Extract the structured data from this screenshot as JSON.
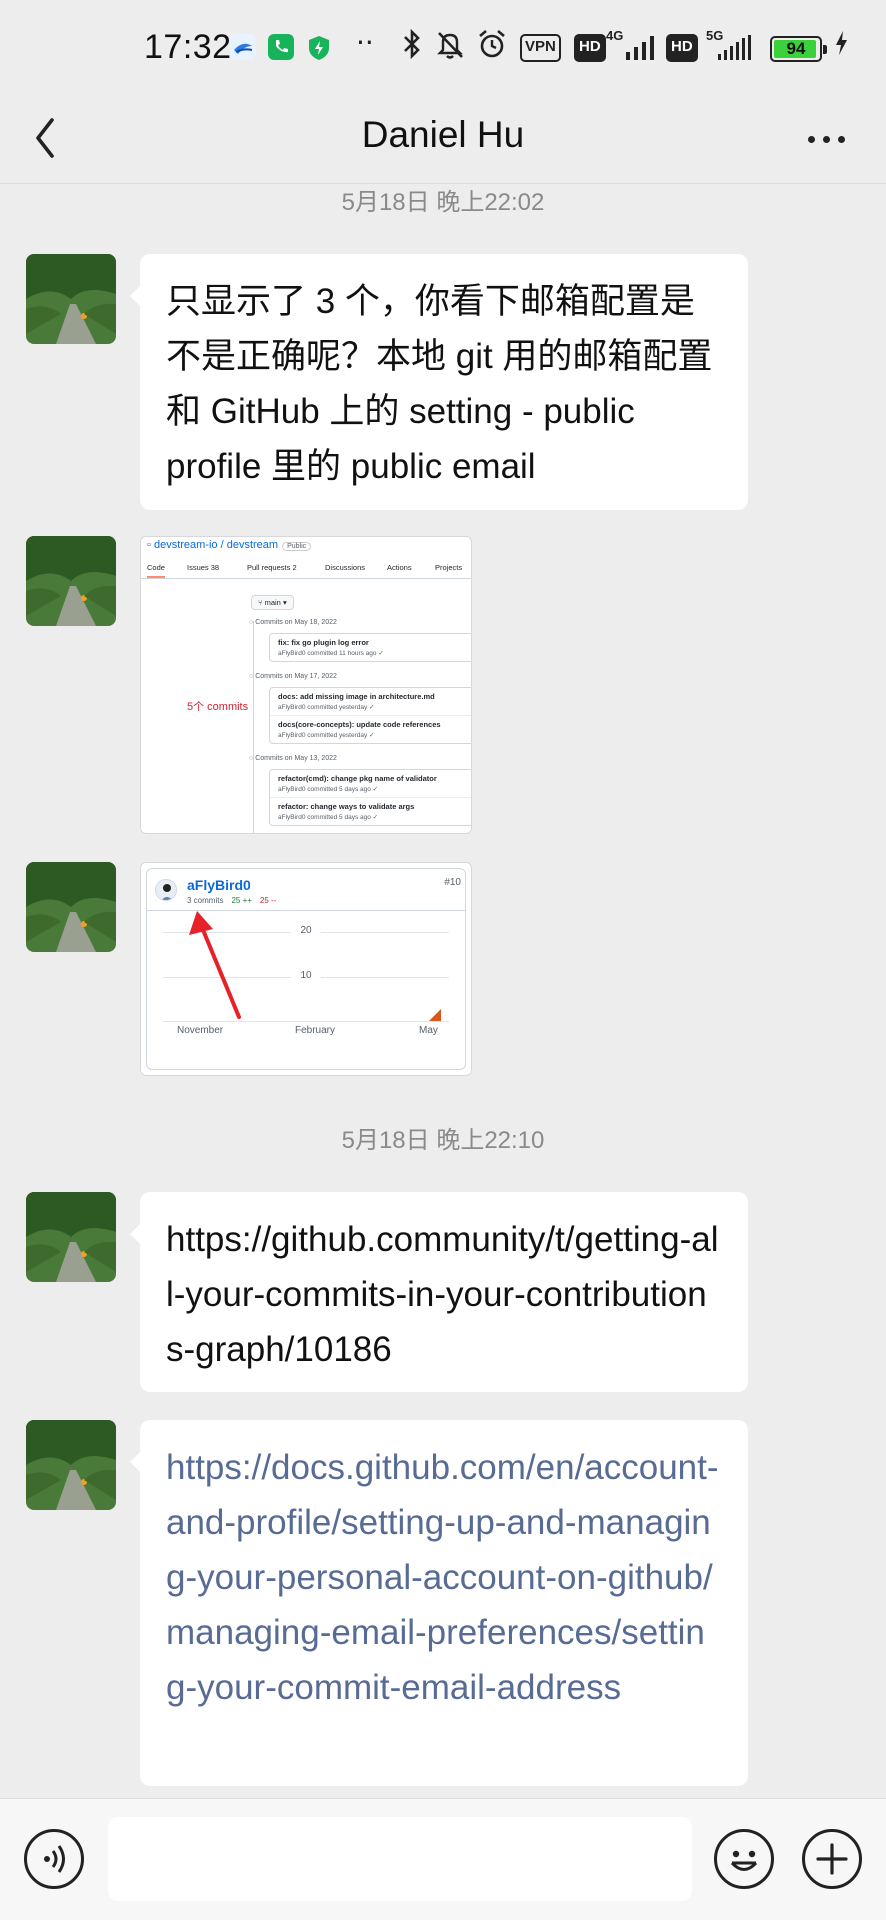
{
  "status_bar": {
    "time": "17:32",
    "dots": "··",
    "vpn": "VPN",
    "hd1": "HD",
    "net1": "4G",
    "hd2": "HD",
    "net2": "5G",
    "battery": "94"
  },
  "nav": {
    "title": "Daniel Hu"
  },
  "messages": [
    {
      "timestamp": "5月18日 晚上22:02"
    },
    {
      "text": "只显示了 3 个，你看下邮箱配置是不是正确呢？本地 git 用的邮箱配置和 GitHub 上的 setting - public profile 里的 public email"
    },
    {
      "image": "github-commits",
      "repo": "devstream-io / devstream",
      "visibility": "Public",
      "tabs": [
        "Code",
        "Issues 38",
        "Pull requests 2",
        "Discussions",
        "Actions",
        "Projects"
      ],
      "branch": "main",
      "annotation": "5个 commits",
      "groups": [
        {
          "date": "Commits on May 18, 2022",
          "commits": [
            {
              "msg": "fix: fix go plugin log error",
              "meta": "aFlyBird0 committed 11 hours ago"
            }
          ]
        },
        {
          "date": "Commits on May 17, 2022",
          "commits": [
            {
              "msg": "docs: add missing image in architecture.md",
              "meta": "aFlyBird0 committed yesterday"
            },
            {
              "msg": "docs(core-concepts): update code references",
              "meta": "aFlyBird0 committed yesterday"
            }
          ]
        },
        {
          "date": "Commits on May 13, 2022",
          "commits": [
            {
              "msg": "refactor(cmd): change pkg name of validator",
              "meta": "aFlyBird0 committed 5 days ago"
            },
            {
              "msg": "refactor: change ways to validate args",
              "meta": "aFlyBird0 committed 5 days ago"
            }
          ]
        }
      ]
    },
    {
      "image": "contributor-card",
      "user": "aFlyBird0",
      "rank": "#10",
      "commits": "3 commits",
      "additions": "25 ++",
      "deletions": "25 --",
      "y_ticks": [
        "20",
        "10"
      ],
      "x_ticks": [
        "November",
        "February",
        "May"
      ]
    },
    {
      "timestamp": "5月18日 晚上22:10"
    },
    {
      "text": "https://github.community/t/getting-all-your-commits-in-your-contributions-graph/10186"
    },
    {
      "text": "https://docs.github.com/en/account-and-profile/setting-up-and-managing-your-personal-account-on-github/managing-email-preferences/setting-your-commit-email-address"
    }
  ],
  "colors": {
    "background": "#ededed",
    "bubble": "#ffffff",
    "link": "#576b95",
    "battery": "#3ad13a"
  },
  "icons": [
    "back-arrow-icon",
    "more-icon",
    "voice-icon",
    "emoji-icon",
    "plus-icon"
  ]
}
